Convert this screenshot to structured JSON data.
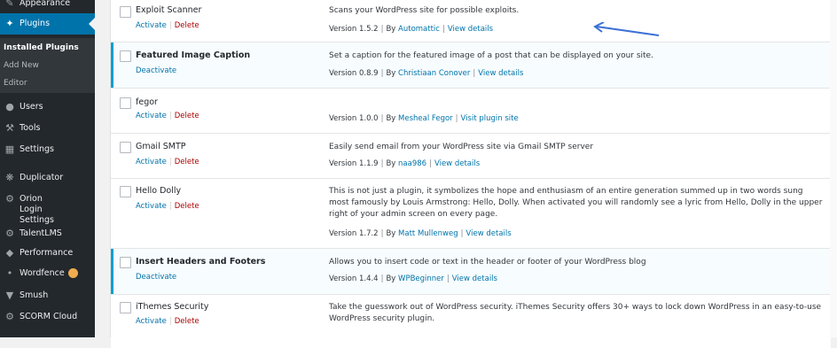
{
  "sidebar": {
    "items": [
      {
        "label": "Appearance",
        "icon": "paintbrush-icon"
      },
      {
        "label": "Plugins",
        "icon": "plug-icon"
      },
      {
        "label": "Users",
        "icon": "user-icon"
      },
      {
        "label": "Tools",
        "icon": "wrench-icon"
      },
      {
        "label": "Settings",
        "icon": "settings-icon"
      },
      {
        "label": "Duplicator",
        "icon": "duplicator-icon"
      },
      {
        "label": "Orion Login Settings",
        "icon": "gear-icon"
      },
      {
        "label": "TalentLMS",
        "icon": "gear-icon"
      },
      {
        "label": "Performance",
        "icon": "performance-icon"
      },
      {
        "label": "Wordfence",
        "icon": "wordfence-icon"
      },
      {
        "label": "Smush",
        "icon": "smush-icon"
      },
      {
        "label": "SCORM Cloud",
        "icon": "gear-icon"
      }
    ],
    "submenu": [
      "Installed Plugins",
      "Add New",
      "Editor"
    ]
  },
  "plugins": [
    {
      "name": "Exploit Scanner",
      "actions": [
        "Activate",
        "Delete"
      ],
      "description": "Scans your WordPress site for possible exploits.",
      "version": "Version 1.5.2",
      "by": "By",
      "author": "Automattic",
      "link": "View details"
    },
    {
      "name": "Featured Image Caption",
      "actions": [
        "Deactivate"
      ],
      "description": "Set a caption for the featured image of a post that can be displayed on your site.",
      "version": "Version 0.8.9",
      "by": "By",
      "author": "Christiaan Conover",
      "link": "View details"
    },
    {
      "name": "fegor",
      "actions": [
        "Activate",
        "Delete"
      ],
      "description": "",
      "version": "Version 1.0.0",
      "by": "By",
      "author": "Mesheal Fegor",
      "link": "Visit plugin site"
    },
    {
      "name": "Gmail SMTP",
      "actions": [
        "Activate",
        "Delete"
      ],
      "description": "Easily send email from your WordPress site via Gmail SMTP server",
      "version": "Version 1.1.9",
      "by": "By",
      "author": "naa986",
      "link": "View details"
    },
    {
      "name": "Hello Dolly",
      "actions": [
        "Activate",
        "Delete"
      ],
      "description": "This is not just a plugin, it symbolizes the hope and enthusiasm of an entire generation summed up in two words sung most famously by Louis Armstrong: Hello, Dolly. When activated you will randomly see a lyric from Hello, Dolly in the upper right of your admin screen on every page.",
      "version": "Version 1.7.2",
      "by": "By",
      "author": "Matt Mullenweg",
      "link": "View details"
    },
    {
      "name": "Insert Headers and Footers",
      "actions": [
        "Deactivate"
      ],
      "description": "Allows you to insert code or text in the header or footer of your WordPress blog",
      "version": "Version 1.4.4",
      "by": "By",
      "author": "WPBeginner",
      "link": "View details"
    },
    {
      "name": "iThemes Security",
      "actions": [
        "Activate",
        "Delete"
      ],
      "description": "Take the guesswork out of WordPress security. iThemes Security offers 30+ ways to lock down WordPress in an easy-to-use WordPress security plugin.",
      "version": "",
      "by": "",
      "author": "",
      "link": ""
    }
  ]
}
